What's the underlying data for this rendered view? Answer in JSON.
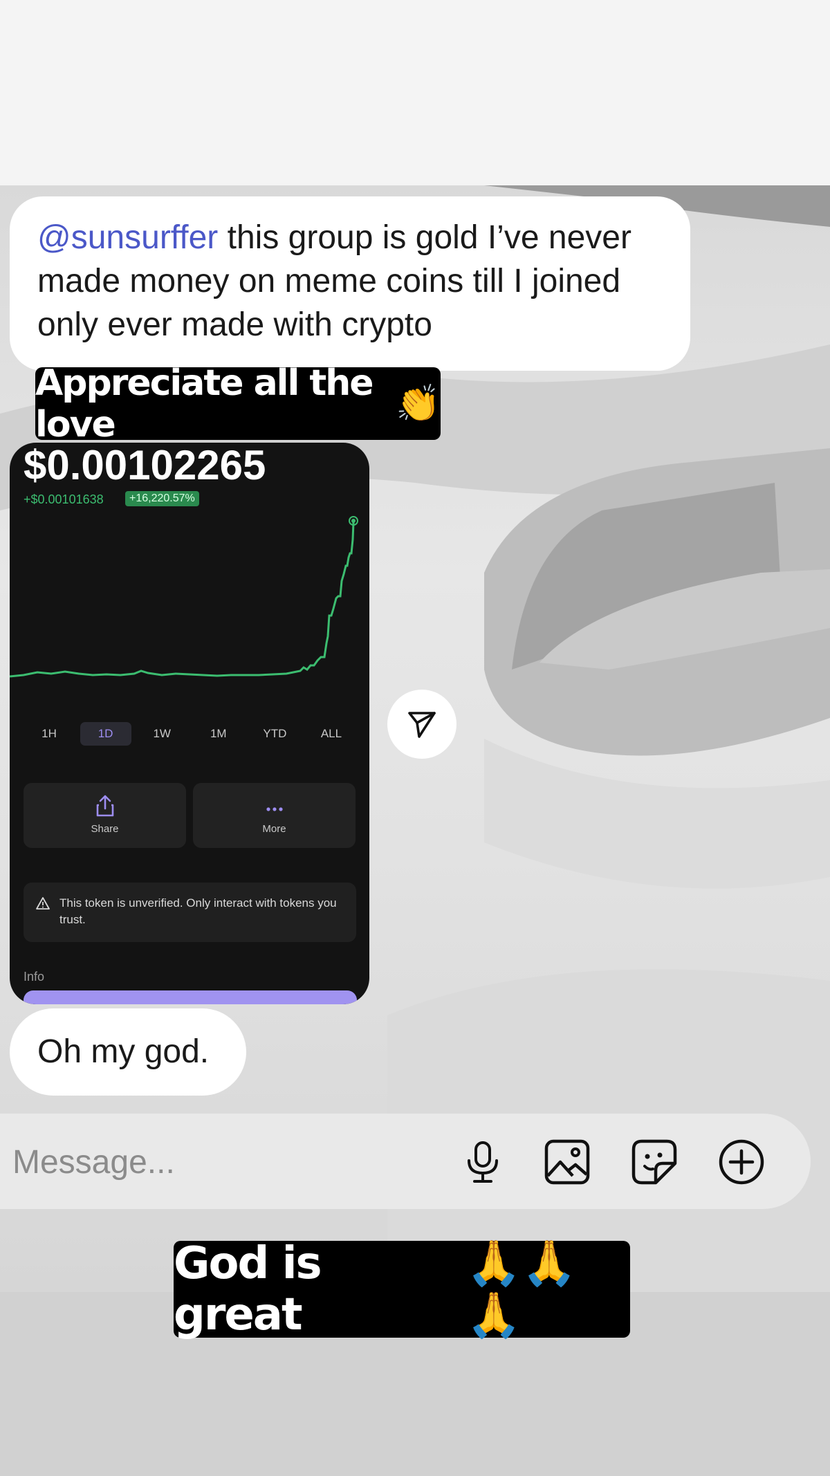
{
  "messages": {
    "first": {
      "mention": "@sunsurffer",
      "text": " this group is gold I’ve never made money on meme coins till I joined only ever made with crypto"
    },
    "second": {
      "text": "Oh my god."
    }
  },
  "captions": {
    "top": {
      "text": "Appreciate all the love",
      "emoji": "👏"
    },
    "bottom": {
      "text": "God is great",
      "emoji": "🙏🙏🙏"
    }
  },
  "token_card": {
    "price": "$0.00102265",
    "change": "+$0.00101638",
    "change_pct": "+16,220.57%",
    "ranges": [
      {
        "label": "1H",
        "active": false
      },
      {
        "label": "1D",
        "active": true
      },
      {
        "label": "1W",
        "active": false
      },
      {
        "label": "1M",
        "active": false
      },
      {
        "label": "YTD",
        "active": false
      },
      {
        "label": "ALL",
        "active": false
      }
    ],
    "share_label": "Share",
    "more_label": "More",
    "warning": "This token is unverified. Only interact with tokens you trust.",
    "info_label": "Info"
  },
  "composer": {
    "placeholder": "Message..."
  },
  "colors": {
    "mention": "#4b58c8",
    "chart_line": "#3cbd70",
    "accent_purple": "#9d8df1"
  },
  "icons": [
    "send-icon",
    "share-icon",
    "more-icon",
    "warning-icon",
    "mic-icon",
    "gallery-icon",
    "sticker-icon",
    "plus-circle-icon"
  ]
}
